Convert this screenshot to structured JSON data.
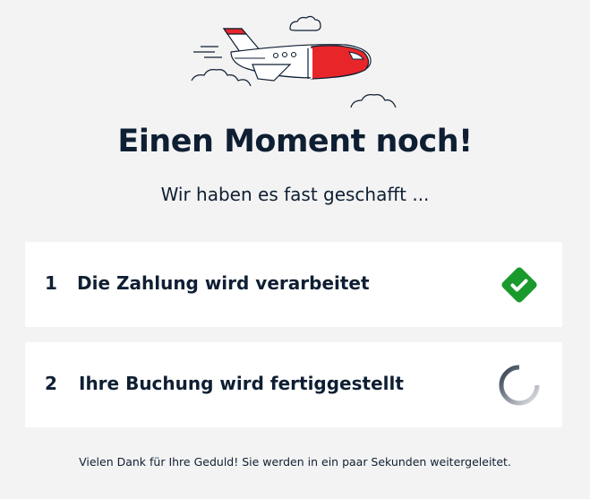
{
  "title": "Einen Moment noch!",
  "subtitle": "Wir haben es fast geschafft ...",
  "steps": [
    {
      "number": "1",
      "label": "Die Zahlung wird verarbeitet",
      "status": "done",
      "status_icon": "check-icon"
    },
    {
      "number": "2",
      "label": "Ihre Buchung wird fertiggestellt",
      "status": "in-progress",
      "status_icon": "spinner-icon"
    }
  ],
  "footer": "Vielen Dank für Ihre Geduld! Sie werden in ein paar Sekunden weitergeleitet.",
  "colors": {
    "background": "#f3f3f3",
    "text": "#0f1f33",
    "accent_red": "#e8262a",
    "success_green": "#1a9a2c"
  },
  "illustration": {
    "icon": "airplane-illustration"
  }
}
